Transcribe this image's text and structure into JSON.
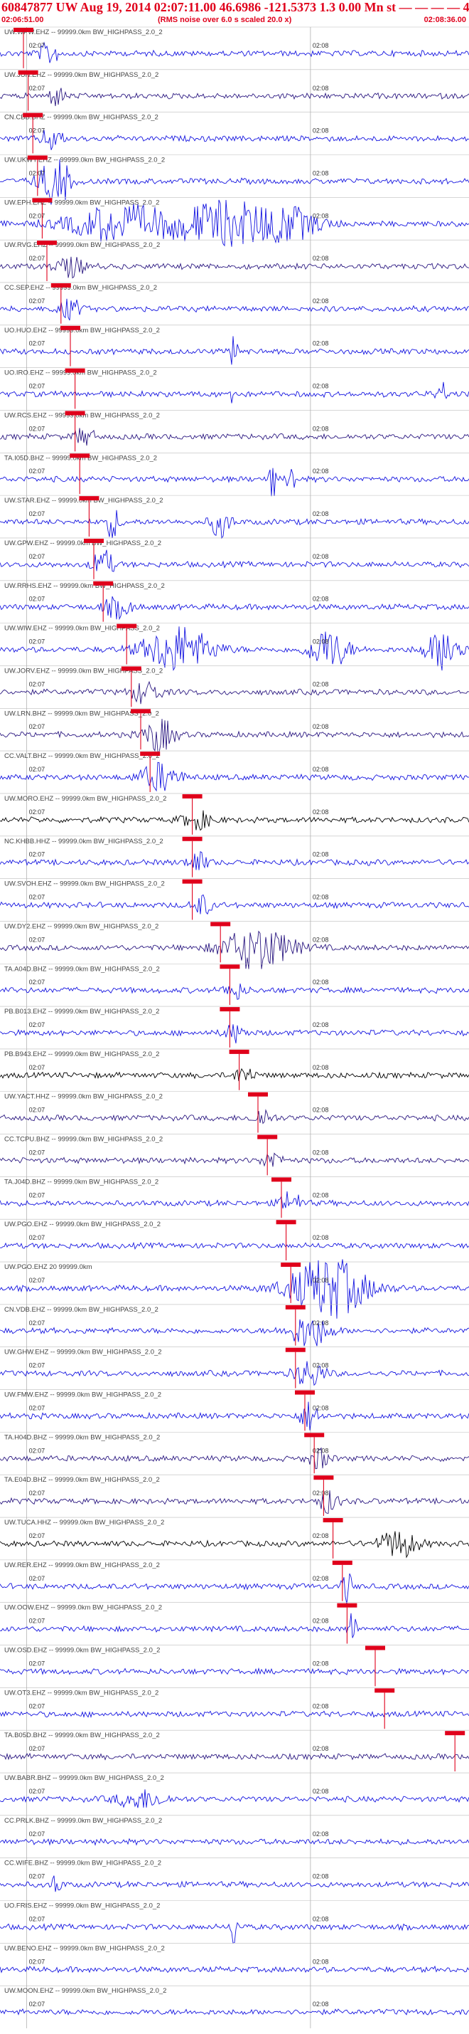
{
  "header": {
    "title": "60847877 UW Aug 19, 2014 02:07:11.00   46.6986 -121.5373  1.3 0.00 Mn st — — — — 4",
    "start_time": "02:06:51.00",
    "noise_note": "(RMS noise over 6.0 s scaled 20.0 x)",
    "end_time": "02:08:36.00"
  },
  "colors": {
    "trace_blue": "#1515e0",
    "trace_purple": "#2a1780",
    "trace_black": "#000000",
    "pick_red": "#e0001b",
    "label_gray": "#444444"
  },
  "chart_data": {
    "type": "seismogram",
    "time_range": [
      "02:06:51.00",
      "02:08:36.00"
    ],
    "grid_ticks": [
      "02:07",
      "02:08"
    ],
    "traces": [
      {
        "label": "UW.WPW.EHZ -- 99999.0km BW_HIGHPASS_2.0_2",
        "color": "blue",
        "pick": 0.05,
        "events": [
          [
            0.105,
            0.02,
            1.6
          ]
        ]
      },
      {
        "label": "UW.JUN.EHZ -- 99999.0km BW_HIGHPASS_2.0_2",
        "color": "purple",
        "pick": 0.06,
        "events": [
          [
            0.12,
            0.015,
            1.5
          ]
        ]
      },
      {
        "label": "CN.CBB.BHZ -- 99999.0km BW_HIGHPASS_2.0_2",
        "color": "blue",
        "pick": 0.07,
        "events": [
          [
            0.11,
            0.02,
            1.7
          ]
        ]
      },
      {
        "label": "UW.UKWY.EHZ -- 99999.0km BW_HIGHPASS_2.0_2",
        "color": "blue",
        "pick": 0.08,
        "events": [
          [
            0.11,
            0.03,
            2.5
          ],
          [
            0.13,
            0.02,
            1.8
          ]
        ]
      },
      {
        "label": "UW.EPH.EHZ -- 99999.0km BW_HIGHPASS_2.0_2",
        "color": "blue",
        "pick": 0.09,
        "events": [
          [
            0.25,
            0.1,
            2.6
          ],
          [
            0.48,
            0.12,
            3.2
          ],
          [
            0.62,
            0.06,
            1.8
          ]
        ]
      },
      {
        "label": "UW.RVG.EHZ -- 99999.0km BW_HIGHPASS_2.0_2",
        "color": "purple",
        "pick": 0.1,
        "events": [
          [
            0.15,
            0.03,
            1.4
          ]
        ]
      },
      {
        "label": "CC.SEP.EHZ -- 99999.0km BW_HIGHPASS_2.0_2",
        "color": "blue",
        "pick": 0.13,
        "events": [
          [
            0.15,
            0.02,
            1.6
          ]
        ]
      },
      {
        "label": "UO.HUO.EHZ -- 99999.0km BW_HIGHPASS_2.0_2",
        "color": "blue",
        "pick": 0.15,
        "events": [
          [
            0.5,
            0.006,
            5.0
          ]
        ]
      },
      {
        "label": "UO.IRO.EHZ -- 99999.0km BW_HIGHPASS_2.0_2",
        "color": "blue",
        "pick": 0.16,
        "events": [
          [
            0.49,
            0.005,
            4.0
          ],
          [
            0.94,
            0.01,
            2.0
          ]
        ]
      },
      {
        "label": "UW.RCS.EHZ -- 99999.0km BW_HIGHPASS_2.0_2",
        "color": "purple",
        "pick": 0.16,
        "events": [
          [
            0.18,
            0.02,
            1.3
          ]
        ]
      },
      {
        "label": "TA.I05D.BHZ -- 99999.0km BW_HIGHPASS_2.0_2",
        "color": "blue",
        "pick": 0.17,
        "events": [
          [
            0.58,
            0.006,
            4.0
          ],
          [
            0.62,
            0.008,
            3.0
          ]
        ]
      },
      {
        "label": "UW.STAR.EHZ -- 99999.0km BW_HIGHPASS_2.0_2",
        "color": "blue",
        "pick": 0.19,
        "events": [
          [
            0.24,
            0.015,
            2.2
          ],
          [
            0.47,
            0.02,
            2.2
          ]
        ]
      },
      {
        "label": "UW.GPW.EHZ -- 99999.0km BW_HIGHPASS_2.0_2",
        "color": "blue",
        "pick": 0.2,
        "events": [
          [
            0.22,
            0.02,
            2.3
          ]
        ]
      },
      {
        "label": "UW.RRHS.EHZ -- 99999.0km BW_HIGHPASS_2.0_2",
        "color": "blue",
        "pick": 0.22,
        "events": [
          [
            0.25,
            0.03,
            1.4
          ]
        ]
      },
      {
        "label": "UW.WIW.EHZ -- 99999.0km BW_HIGHPASS_2.0_2",
        "color": "blue",
        "pick": 0.27,
        "events": [
          [
            0.38,
            0.07,
            3.4
          ],
          [
            0.7,
            0.04,
            3.0
          ],
          [
            0.95,
            0.04,
            3.0
          ]
        ]
      },
      {
        "label": "UW.JORV.EHZ -- 99999.0km BW_HIGHPASS_2.0_2",
        "color": "purple",
        "pick": 0.28,
        "events": [
          [
            0.31,
            0.03,
            1.6
          ]
        ]
      },
      {
        "label": "UW.LRN.BHZ -- 99999.0km BW_HIGHPASS_2.0_2",
        "color": "purple",
        "pick": 0.3,
        "events": [
          [
            0.34,
            0.03,
            2.5
          ]
        ]
      },
      {
        "label": "CC.VALT.BHZ -- 99999.0km BW_HIGHPASS_2.0_2",
        "color": "blue",
        "pick": 0.32,
        "events": [
          [
            0.34,
            0.04,
            2.0
          ]
        ]
      },
      {
        "label": "UW.MORO.EHZ -- 99999.0km BW_HIGHPASS_2.0_2",
        "color": "black",
        "pick": 0.41,
        "events": [
          [
            0.42,
            0.03,
            1.3
          ]
        ]
      },
      {
        "label": "NC.KHBB.HHZ -- 99999.0km BW_HIGHPASS_2.0_2",
        "color": "blue",
        "pick": 0.41,
        "events": [
          [
            0.42,
            0.02,
            1.6
          ]
        ]
      },
      {
        "label": "UW.SVOH.EHZ -- 99999.0km BW_HIGHPASS_2.0_2",
        "color": "blue",
        "pick": 0.41,
        "events": [
          [
            0.43,
            0.02,
            1.5
          ]
        ]
      },
      {
        "label": "UW.DY2.EHZ -- 99999.0km BW_HIGHPASS_2.0_2",
        "color": "purple",
        "pick": 0.47,
        "events": [
          [
            0.55,
            0.07,
            3.2
          ]
        ]
      },
      {
        "label": "TA.A04D.BHZ -- 99999.0km BW_HIGHPASS_2.0_2",
        "color": "blue",
        "pick": 0.49,
        "events": [
          [
            0.5,
            0.02,
            1.3
          ]
        ]
      },
      {
        "label": "PB.B013.EHZ -- 99999.0km BW_HIGHPASS_2.0_2",
        "color": "blue",
        "pick": 0.49,
        "events": [
          [
            0.5,
            0.02,
            1.3
          ]
        ]
      },
      {
        "label": "PB.B943.EHZ -- 99999.0km BW_HIGHPASS_2.0_2",
        "color": "black",
        "pick": 0.51,
        "events": [
          [
            0.52,
            0.02,
            1.2
          ]
        ]
      },
      {
        "label": "UW.YACT.HHZ -- 99999.0km BW_HIGHPASS_2.0_2",
        "color": "purple",
        "pick": 0.55,
        "events": [
          [
            0.56,
            0.02,
            1.3
          ]
        ]
      },
      {
        "label": "CC.TCPU.BHZ -- 99999.0km BW_HIGHPASS_2.0_2",
        "color": "purple",
        "pick": 0.57,
        "events": [
          [
            0.58,
            0.02,
            1.3
          ]
        ]
      },
      {
        "label": "TA.J04D.BHZ -- 99999.0km BW_HIGHPASS_2.0_2",
        "color": "blue",
        "pick": 0.6,
        "events": [
          [
            0.62,
            0.02,
            1.9
          ]
        ]
      },
      {
        "label": "UW.PGO.EHZ -- 99999.0km BW_HIGHPASS_2.0_2",
        "color": "blue",
        "pick": 0.61,
        "events": []
      },
      {
        "label": "UW.PGO.EHZ 20 99999.0km",
        "color": "blue",
        "pick": 0.62,
        "events": [
          [
            0.7,
            0.08,
            4.5
          ]
        ]
      },
      {
        "label": "CN.VDB.EHZ -- 99999.0km BW_HIGHPASS_2.0_2",
        "color": "blue",
        "pick": 0.63,
        "events": [
          [
            0.66,
            0.04,
            2.5
          ]
        ]
      },
      {
        "label": "UW.GHW.EHZ -- 99999.0km BW_HIGHPASS_2.0_2",
        "color": "blue",
        "pick": 0.63,
        "events": [
          [
            0.66,
            0.03,
            2.0
          ]
        ]
      },
      {
        "label": "UW.FMW.EHZ -- 99999.0km BW_HIGHPASS_2.0_2",
        "color": "blue",
        "pick": 0.65,
        "events": [
          [
            0.66,
            0.02,
            2.0
          ]
        ]
      },
      {
        "label": "TA.H04D.BHZ -- 99999.0km BW_HIGHPASS_2.0_2",
        "color": "purple",
        "pick": 0.67,
        "events": [
          [
            0.68,
            0.02,
            1.5
          ]
        ]
      },
      {
        "label": "TA.E04D.BHZ -- 99999.0km BW_HIGHPASS_2.0_2",
        "color": "purple",
        "pick": 0.69,
        "events": [
          [
            0.7,
            0.02,
            1.6
          ]
        ]
      },
      {
        "label": "UW.TUCA.HHZ -- 99999.0km BW_HIGHPASS_2.0_2",
        "color": "black",
        "pick": 0.71,
        "events": [
          [
            0.85,
            0.04,
            2.0
          ]
        ]
      },
      {
        "label": "UW.RER.EHZ -- 99999.0km BW_HIGHPASS_2.0_2",
        "color": "blue",
        "pick": 0.73,
        "events": [
          [
            0.74,
            0.01,
            2.5
          ]
        ]
      },
      {
        "label": "UW.OOW.EHZ -- 99999.0km BW_HIGHPASS_2.0_2",
        "color": "blue",
        "pick": 0.74,
        "events": [
          [
            0.75,
            0.008,
            3.0
          ]
        ]
      },
      {
        "label": "UW.OSD.EHZ -- 99999.0km BW_HIGHPASS_2.0_2",
        "color": "blue",
        "pick": 0.8,
        "events": []
      },
      {
        "label": "UW.OT3.EHZ -- 99999.0km BW_HIGHPASS_2.0_2",
        "color": "blue",
        "pick": 0.82,
        "events": []
      },
      {
        "label": "TA.B05D.BHZ -- 99999.0km BW_HIGHPASS_2.0_2",
        "color": "purple",
        "pick": 0.97,
        "events": []
      },
      {
        "label": "UW.BABR.BHZ -- 99999.0km BW_HIGHPASS_2.0_2",
        "color": "blue",
        "pick": null,
        "events": [
          [
            0.3,
            0.05,
            1.3
          ]
        ]
      },
      {
        "label": "CC.PRLK.BHZ -- 99999.0km BW_HIGHPASS_2.0_2",
        "color": "blue",
        "pick": null,
        "events": []
      },
      {
        "label": "CC.WIFE.BHZ -- 99999.0km BW_HIGHPASS_2.0_2",
        "color": "blue",
        "pick": null,
        "events": [
          [
            0.12,
            0.01,
            1.5
          ]
        ]
      },
      {
        "label": "UO.FRIS.EHZ -- 99999.0km BW_HIGHPASS_2.0_2",
        "color": "blue",
        "pick": null,
        "events": [
          [
            0.5,
            0.006,
            3.5
          ]
        ]
      },
      {
        "label": "UW.BENO.EHZ -- 99999.0km BW_HIGHPASS_2.0_2",
        "color": "blue",
        "pick": null,
        "events": []
      },
      {
        "label": "UW.MOON.EHZ -- 99999.0km BW_HIGHPASS_2.0_2",
        "color": "blue",
        "pick": null,
        "events": []
      }
    ]
  }
}
